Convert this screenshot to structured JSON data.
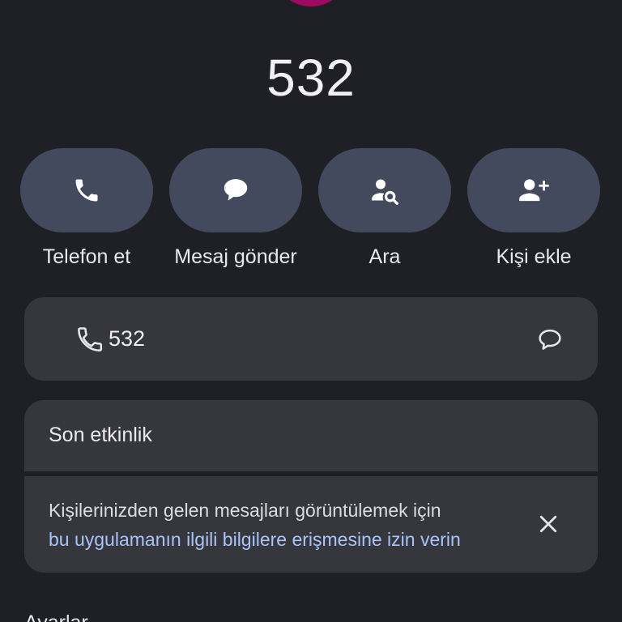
{
  "contact": {
    "title": "532",
    "avatar_color": "#9e0a62"
  },
  "actions": [
    {
      "label": "Telefon et",
      "icon": "phone-icon"
    },
    {
      "label": "Mesaj gönder",
      "icon": "message-icon"
    },
    {
      "label": "Ara",
      "icon": "person-search-icon"
    },
    {
      "label": "Kişi ekle",
      "icon": "add-person-icon"
    }
  ],
  "phone_entry": {
    "number": "532",
    "left_icon": "phone-icon",
    "right_icon": "message-outline-icon"
  },
  "recent_activity": {
    "heading": "Son etkinlik",
    "notice_text": "Kişilerinizden gelen mesajları görüntülemek için",
    "notice_link": "bu uygulamanın ilgili bilgilere erişmesine izin verin",
    "link_color": "#a8c4f8",
    "dismiss_icon": "close-icon"
  },
  "settings": {
    "heading": "Ayarlar"
  },
  "colors": {
    "background": "#1f2025",
    "card": "#36373c",
    "action_pill": "#444a5d"
  }
}
